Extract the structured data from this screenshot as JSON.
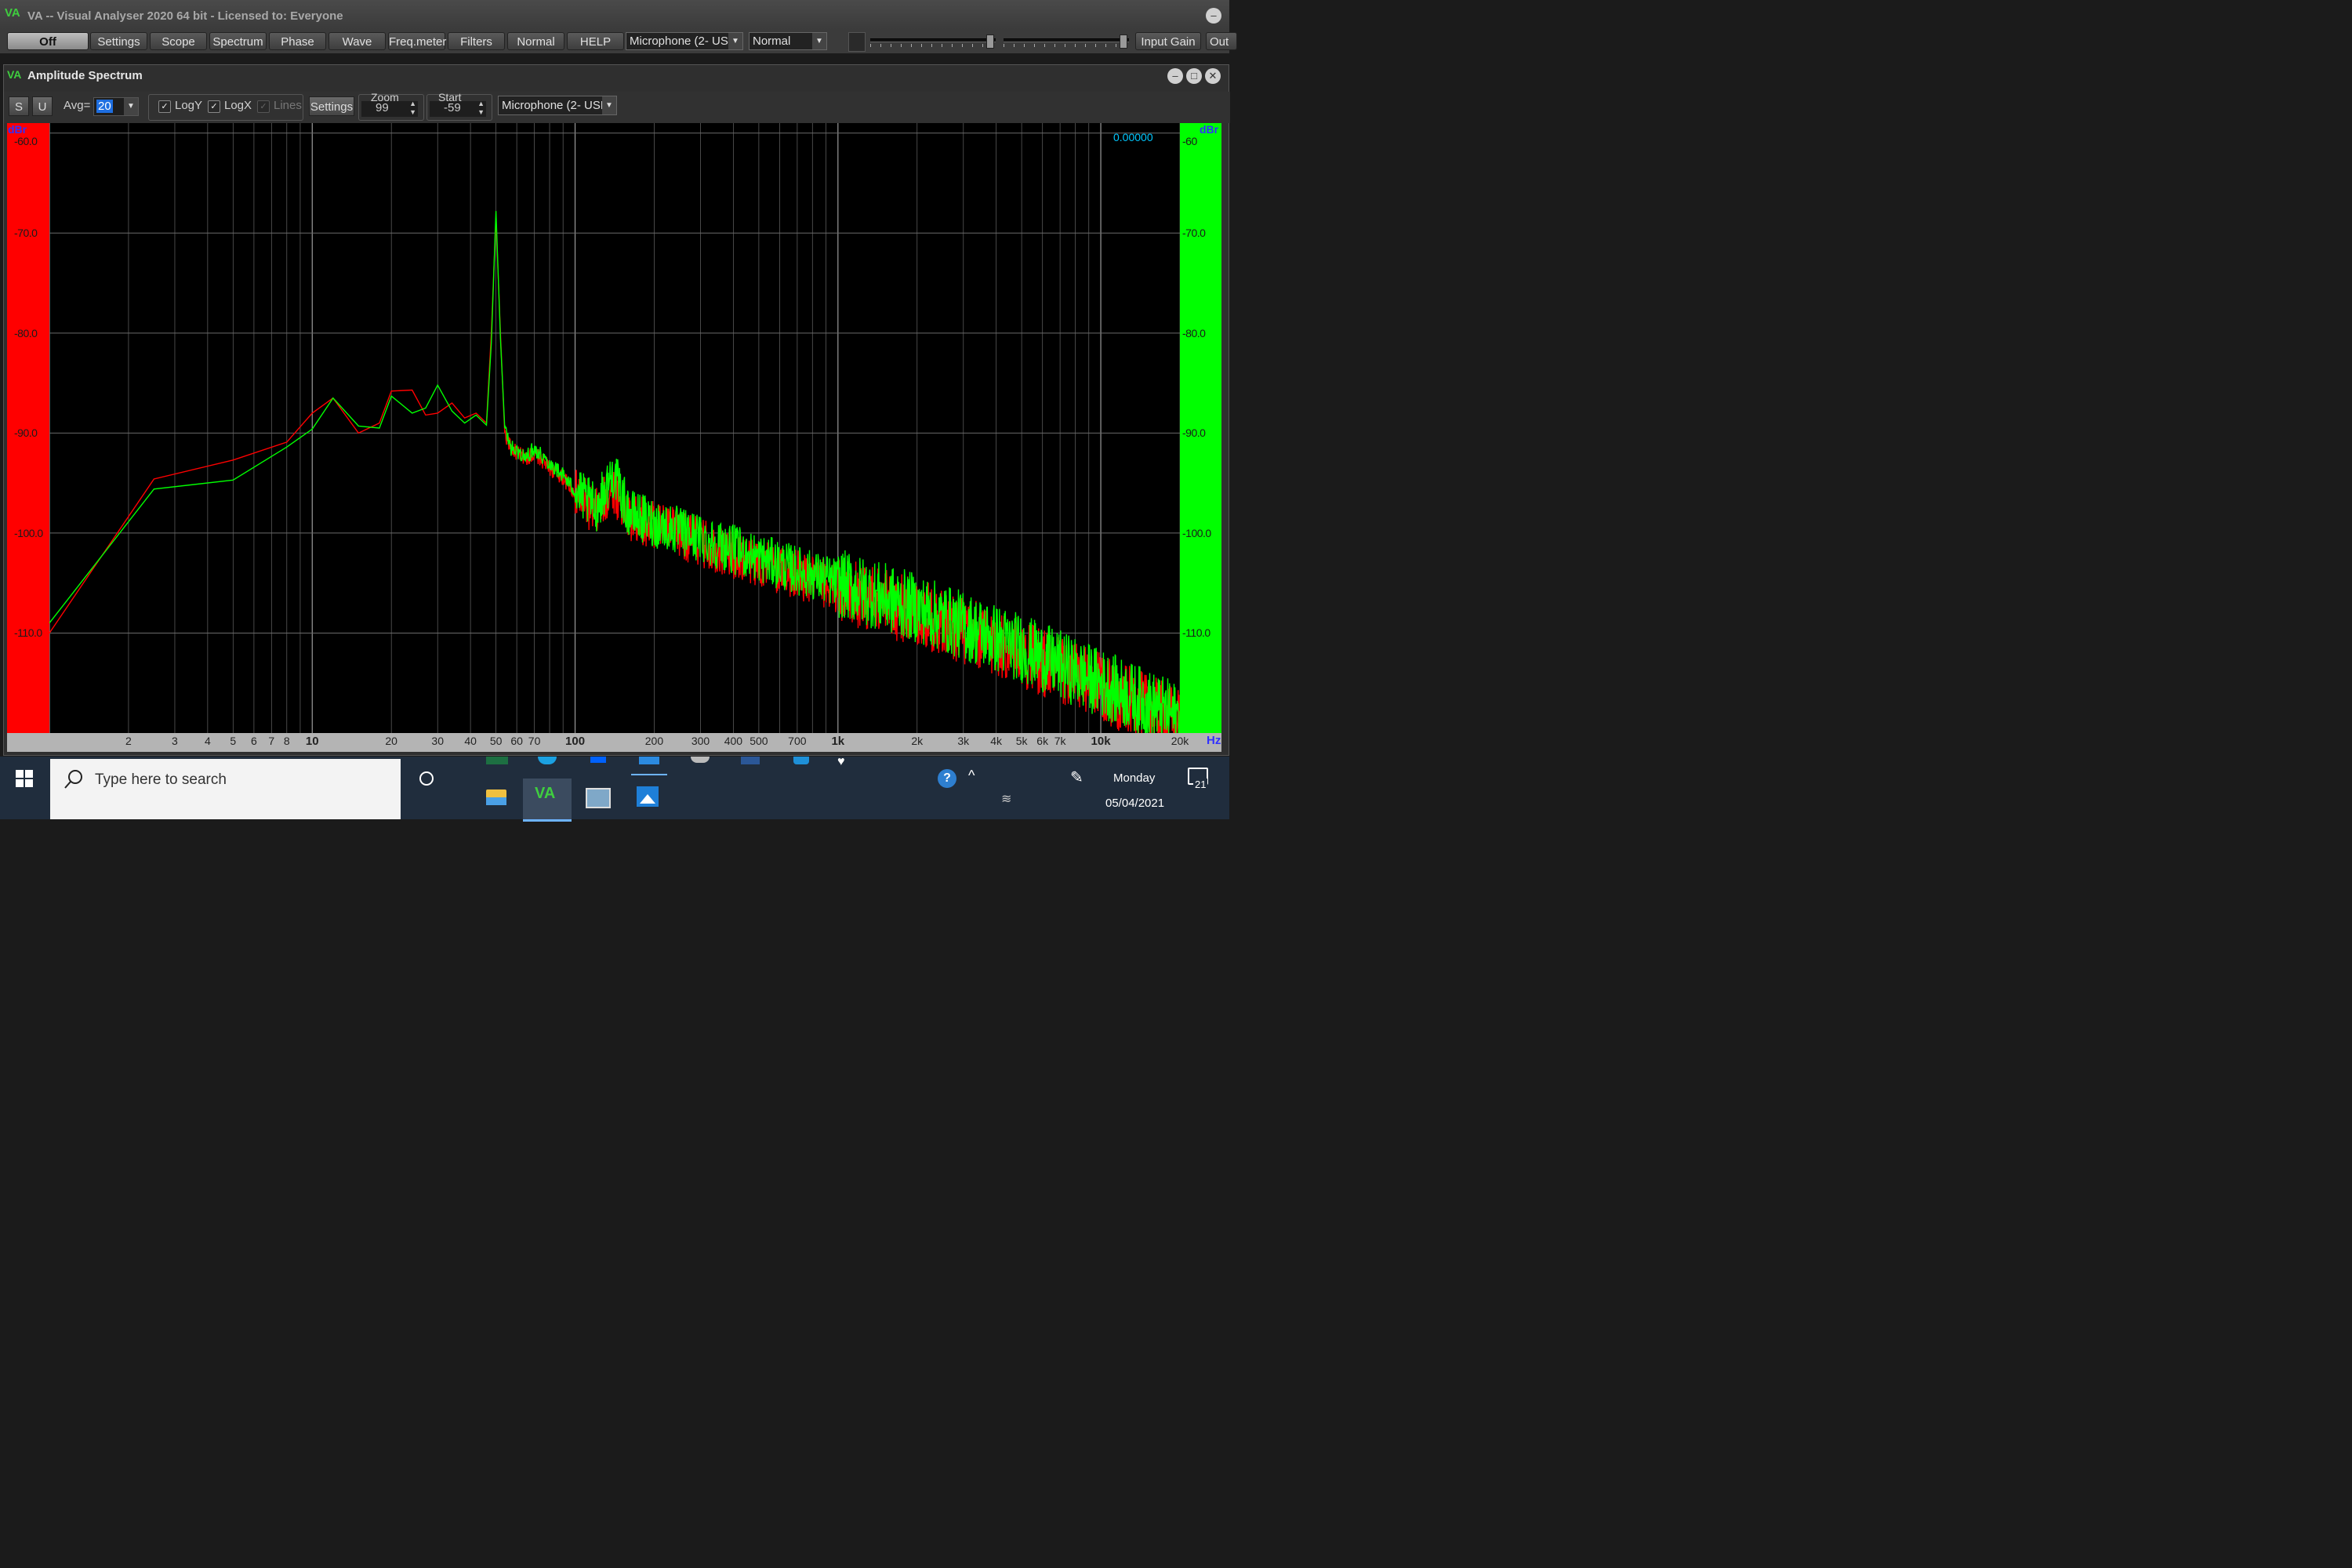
{
  "window": {
    "logo": "VA",
    "title": "VA -- Visual Analyser 2020 64 bit - Licensed to: Everyone"
  },
  "mainbar": {
    "buttons": [
      "Off",
      "Settings",
      "Scope",
      "Spectrum",
      "Phase",
      "Wave",
      "Freq.meter",
      "Filters",
      "Normal",
      "HELP"
    ],
    "device_select": "Microphone (2- USB",
    "mode_select": "Normal",
    "input_gain": "Input Gain",
    "output_cut": "Out"
  },
  "subwindow": {
    "title": "Amplitude Spectrum",
    "s_label": "S",
    "u_label": "U",
    "avg_label": "Avg=",
    "avg_value": "20",
    "logy_label": "LogY",
    "logx_label": "LogX",
    "lines_label": "Lines",
    "settings_label": "Settings",
    "zoom_label": "Zoom",
    "zoom_value": "99",
    "start_label": "Start",
    "start_value": "-59",
    "device_select": "Microphone (2- USB",
    "readout": "0.00000"
  },
  "colors": {
    "left_channel": "#ff0000",
    "right_channel": "#00ff00",
    "readout": "#00c8ff"
  },
  "chart_data": {
    "type": "line",
    "xlabel": "Hz",
    "ylabel": "dBr",
    "x_scale": "log",
    "xlim": [
      1,
      20000
    ],
    "ylim": [
      -120,
      -59
    ],
    "y_ticks": [
      -60,
      -70,
      -80,
      -90,
      -100,
      -110
    ],
    "y_tick_labels_left": [
      "-60.0",
      "-70.0",
      "-80.0",
      "-90.0",
      "-100.0",
      "-110.0"
    ],
    "y_tick_labels_right": [
      "-60",
      "-70.0",
      "-80.0",
      "-90.0",
      "-100.0",
      "-110.0"
    ],
    "x_tick_labels": [
      {
        "x": 2,
        "label": "2"
      },
      {
        "x": 3,
        "label": "3"
      },
      {
        "x": 4,
        "label": "4"
      },
      {
        "x": 5,
        "label": "5"
      },
      {
        "x": 6,
        "label": "6"
      },
      {
        "x": 7,
        "label": "7"
      },
      {
        "x": 8,
        "label": "8"
      },
      {
        "x": 10,
        "label": "10"
      },
      {
        "x": 20,
        "label": "20"
      },
      {
        "x": 30,
        "label": "30"
      },
      {
        "x": 40,
        "label": "40"
      },
      {
        "x": 50,
        "label": "50"
      },
      {
        "x": 60,
        "label": "60"
      },
      {
        "x": 70,
        "label": "70"
      },
      {
        "x": 100,
        "label": "100"
      },
      {
        "x": 200,
        "label": "200"
      },
      {
        "x": 300,
        "label": "300"
      },
      {
        "x": 400,
        "label": "400"
      },
      {
        "x": 500,
        "label": "500"
      },
      {
        "x": 700,
        "label": "700"
      },
      {
        "x": 1000,
        "label": "1k"
      },
      {
        "x": 2000,
        "label": "2k"
      },
      {
        "x": 3000,
        "label": "3k"
      },
      {
        "x": 4000,
        "label": "4k"
      },
      {
        "x": 5000,
        "label": "5k"
      },
      {
        "x": 6000,
        "label": "6k"
      },
      {
        "x": 7000,
        "label": "7k"
      },
      {
        "x": 10000,
        "label": "10k"
      },
      {
        "x": 20000,
        "label": "20k"
      }
    ],
    "series": [
      {
        "color": "#ff0000",
        "x": [
          1.0,
          2.5,
          5.0,
          8.0,
          10.0,
          12.0,
          15.0,
          18.0,
          20.0,
          24.0,
          27.0,
          30.0,
          34.0,
          38.0,
          42.0,
          46.0,
          48.0,
          50.0,
          52.0,
          54.0,
          57.0,
          60.0,
          65.0,
          70.0,
          80.0,
          90.0,
          100.0,
          120.0,
          140.0,
          160.0,
          200.0,
          300.0,
          500.0,
          1000.0,
          2000.0,
          5000.0,
          10000.0,
          20000.0
        ],
        "y": [
          -110.0,
          -94.6,
          -92.7,
          -90.9,
          -88.0,
          -86.5,
          -90.0,
          -89.0,
          -85.8,
          -85.7,
          -88.2,
          -88.0,
          -87.0,
          -88.5,
          -88.0,
          -89.0,
          -80.0,
          -68.5,
          -80.0,
          -90.0,
          -91.5,
          -92.0,
          -92.5,
          -92.0,
          -93.5,
          -94.5,
          -96.0,
          -98.0,
          -95.5,
          -98.5,
          -99.0,
          -101.0,
          -103.0,
          -105.5,
          -108.0,
          -112.0,
          -115.5,
          -119.0
        ]
      },
      {
        "color": "#00ff00",
        "x": [
          1.0,
          2.5,
          5.0,
          8.0,
          10.0,
          12.0,
          15.0,
          18.0,
          20.0,
          24.0,
          27.0,
          30.0,
          34.0,
          38.0,
          42.0,
          46.0,
          48.0,
          50.0,
          52.0,
          54.0,
          57.0,
          60.0,
          65.0,
          70.0,
          80.0,
          90.0,
          100.0,
          120.0,
          140.0,
          160.0,
          200.0,
          300.0,
          500.0,
          1000.0,
          2000.0,
          5000.0,
          10000.0,
          20000.0
        ],
        "y": [
          -109.0,
          -95.6,
          -94.7,
          -91.4,
          -89.6,
          -86.5,
          -89.3,
          -89.5,
          -86.3,
          -88.0,
          -87.5,
          -85.2,
          -87.8,
          -89.0,
          -88.2,
          -89.2,
          -81.0,
          -67.8,
          -80.5,
          -89.5,
          -91.5,
          -91.8,
          -92.5,
          -91.5,
          -93.0,
          -94.2,
          -95.8,
          -97.5,
          -94.0,
          -98.0,
          -99.0,
          -100.5,
          -102.5,
          -105.0,
          -107.5,
          -111.5,
          -115.0,
          -118.5
        ]
      }
    ]
  },
  "taskbar": {
    "search_placeholder": "Type here to search",
    "day": "Monday",
    "date": "05/04/2021",
    "notification_count": "21",
    "va_icon_label": "VA"
  }
}
